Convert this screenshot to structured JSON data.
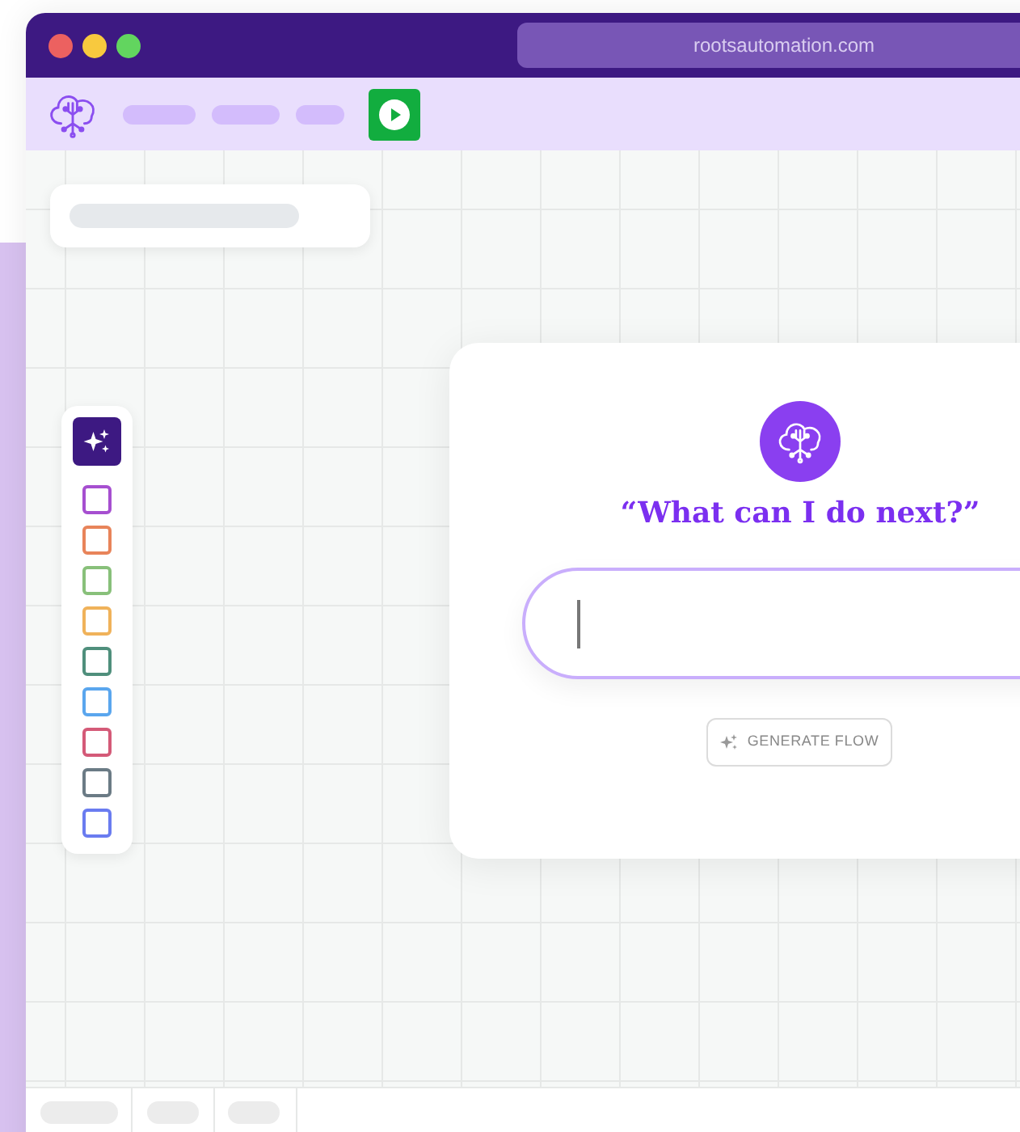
{
  "window": {
    "address": "rootsautomation.com"
  },
  "tool_palette": {
    "items": [
      {
        "kind": "checkbox",
        "color": "#a64fd0",
        "checked": false
      },
      {
        "kind": "checkbox",
        "color": "#e8845a",
        "checked": false
      },
      {
        "kind": "checkbox",
        "color": "#88c07a",
        "checked": false
      },
      {
        "kind": "checkbox",
        "color": "#f0b25a",
        "checked": false
      },
      {
        "kind": "checkbox",
        "color": "#4f8f7c",
        "checked": false
      },
      {
        "kind": "checkbox",
        "color": "#5aa6ee",
        "checked": false
      },
      {
        "kind": "checkbox",
        "color": "#d45a78",
        "checked": false
      },
      {
        "kind": "checkbox",
        "color": "#6b7b85",
        "checked": false
      },
      {
        "kind": "checkbox",
        "color": "#6a7cf0",
        "checked": false
      }
    ]
  },
  "prompt_card": {
    "title": "“What can I do next?”",
    "button": "GENERATE FLOW"
  }
}
